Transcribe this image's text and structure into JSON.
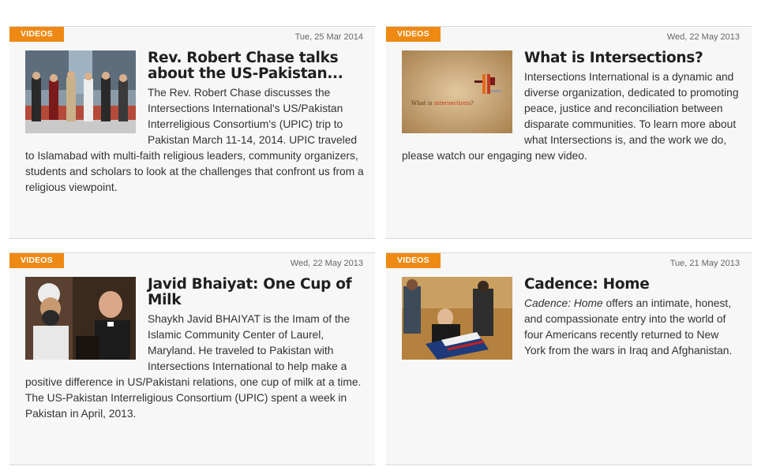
{
  "cards": [
    {
      "tag": "VIDEOS",
      "date": "Tue, 25 Mar 2014",
      "title": "Rev. Robert Chase talks about the US-Pakistan...",
      "description": "The Rev. Robert Chase discusses the Intersections International's US/Pakistan Interreligious Consortium's (UPIC) trip to Pakistan March 11-14, 2014.  UPIC traveled to Islamabad with multi-faith religious leaders, community organizers, students and scholars to look at the challenges that confront us from a religious viewpoint."
    },
    {
      "tag": "VIDEOS",
      "date": "Wed, 22 May 2013",
      "title": "What is Intersections?",
      "description": "Intersections International is a dynamic and diverse organization, dedicated to promoting peace, justice and reconciliation between disparate communities. To learn more about what Intersections is, and the work we do, please watch our engaging new video.",
      "thumb_text_1": "What is ",
      "thumb_text_2": "intersections",
      "thumb_text_3": "?"
    },
    {
      "tag": "VIDEOS",
      "date": "Wed, 22 May 2013",
      "title": "Javid Bhaiyat: One Cup of Milk",
      "description": "Shaykh Javid BHAIYAT is the Imam of the Islamic Community Center of Laurel, Maryland. He traveled to Pakistan with Intersections International to help make a positive difference in US/Pakistani relations, one cup of milk at a time. The US-Pakistan Interreligious Consortium (UPIC) spent a week in Pakistan in April, 2013."
    },
    {
      "tag": "VIDEOS",
      "date": "Tue, 21 May 2013",
      "title": "Cadence: Home",
      "description_em": "Cadence: Home",
      "description": " offers an intimate, honest, and compassionate entry into the world of four Americans recently returned to New York from the wars in Iraq and Afghanistan."
    }
  ],
  "colors": {
    "tag_bg": "#ee8a14",
    "card_bg": "#f7f7f7"
  }
}
